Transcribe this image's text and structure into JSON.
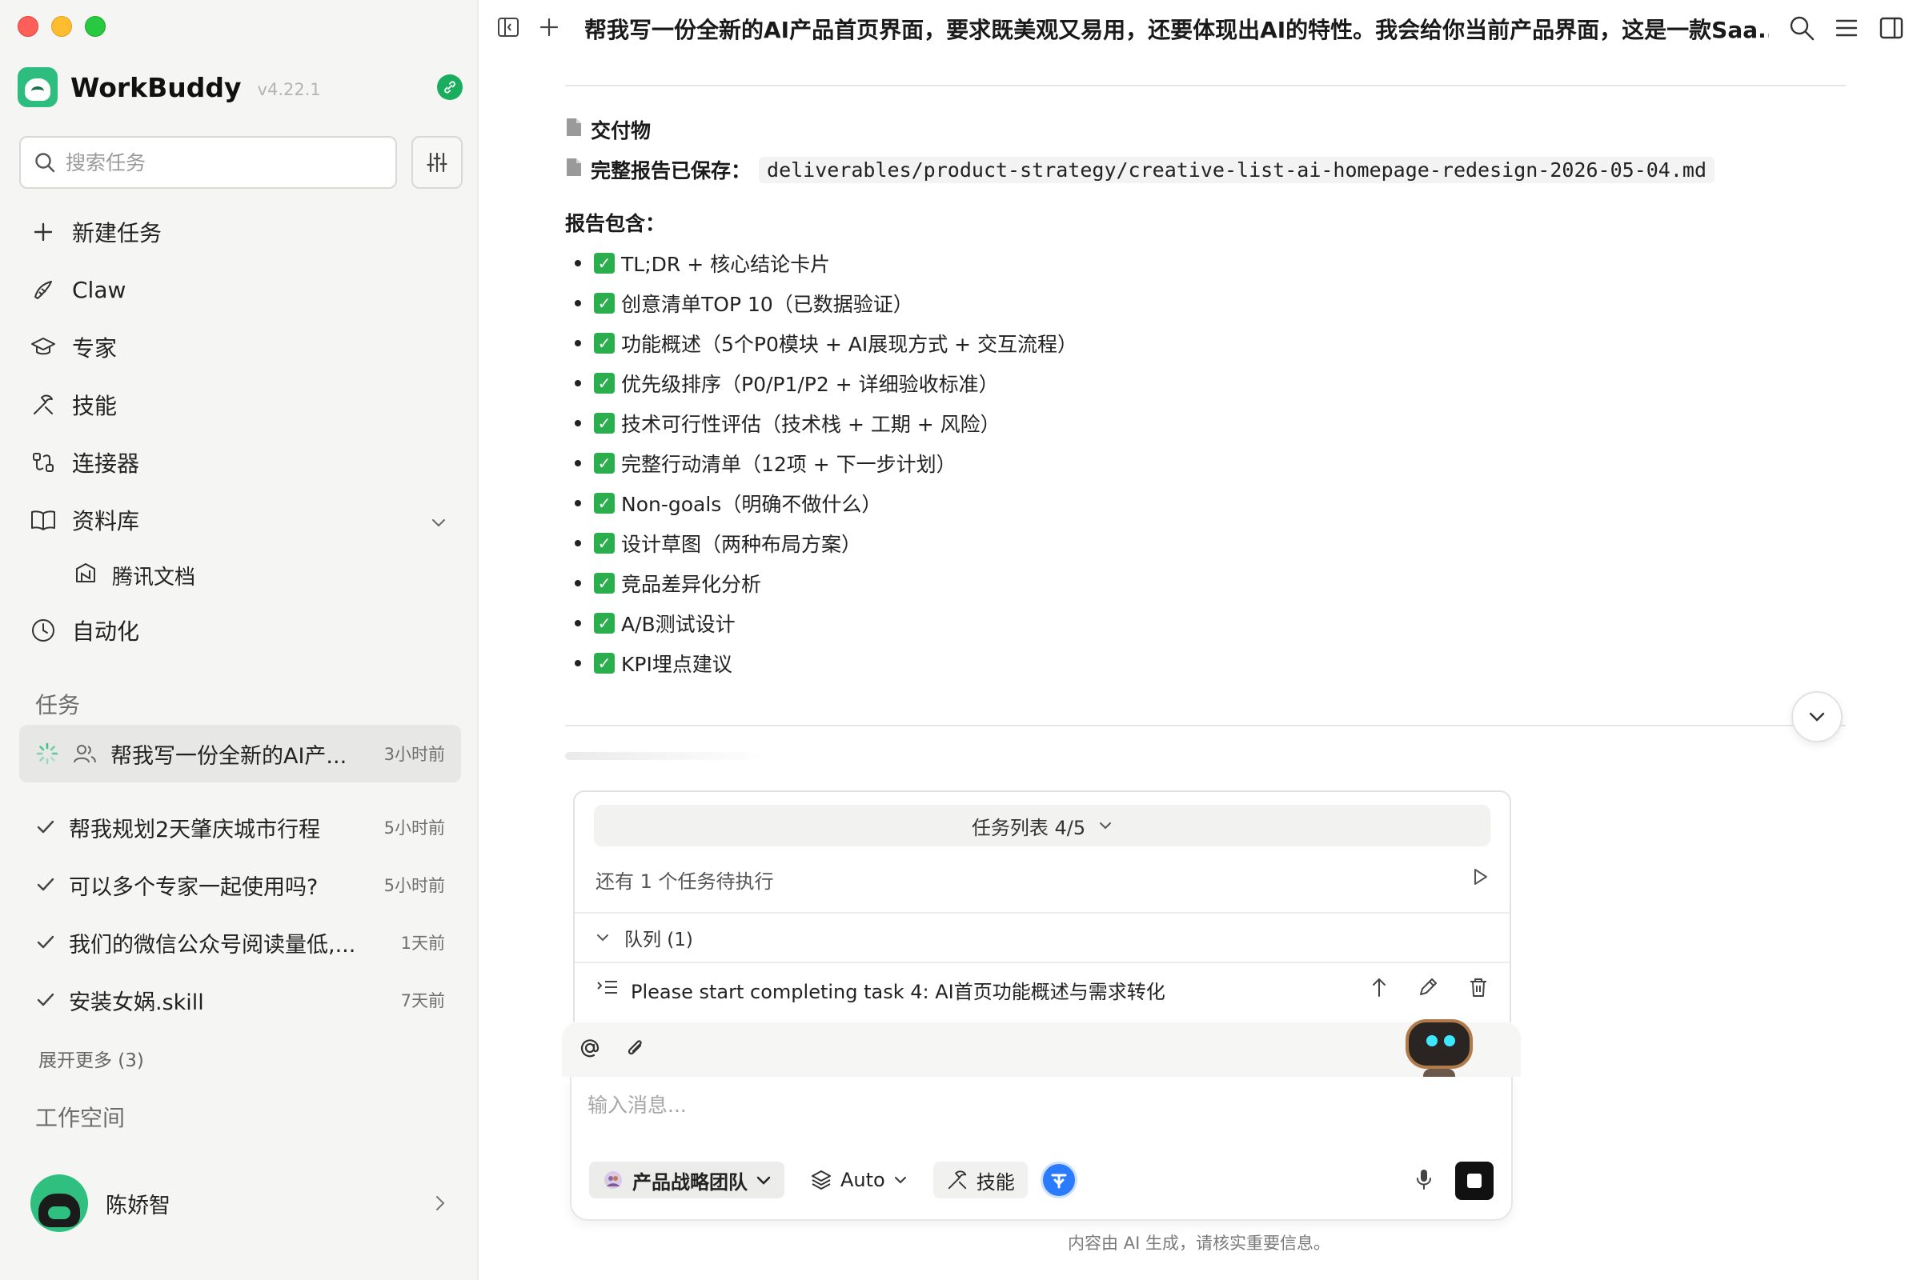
{
  "app": {
    "name": "WorkBuddy",
    "version": "v4.22.1"
  },
  "sidebar": {
    "search_placeholder": "搜索任务",
    "nav": [
      {
        "label": "新建任务",
        "icon": "plus-icon"
      },
      {
        "label": "Claw",
        "icon": "claw-icon"
      },
      {
        "label": "专家",
        "icon": "graduation-cap-icon"
      },
      {
        "label": "技能",
        "icon": "tools-icon"
      },
      {
        "label": "连接器",
        "icon": "plug-icon"
      },
      {
        "label": "资料库",
        "icon": "book-icon"
      },
      {
        "label": "自动化",
        "icon": "clock-icon"
      }
    ],
    "library_sub": "腾讯文档",
    "tasks_label": "任务",
    "tasks": [
      {
        "title": "帮我写一份全新的AI产...",
        "time": "3小时前",
        "status": "running"
      },
      {
        "title": "帮我规划2天肇庆城市行程",
        "time": "5小时前",
        "status": "done"
      },
      {
        "title": "可以多个专家一起使用吗?",
        "time": "5小时前",
        "status": "done"
      },
      {
        "title": "我们的微信公众号阅读量低,...",
        "time": "1天前",
        "status": "done"
      },
      {
        "title": "安装女娲.skill",
        "time": "7天前",
        "status": "done"
      }
    ],
    "show_more": "展开更多 (3)",
    "workspace_label": "工作空间",
    "user_name": "陈娇智"
  },
  "topbar": {
    "title": "帮我写一份全新的AI产品首页界面，要求既美观又易用，还要体现出AI的特性。我会给你当前产品界面，这是一款Saa..."
  },
  "content": {
    "deliverables_label": "交付物",
    "report_saved_label": "完整报告已保存：",
    "report_path": "deliverables/product-strategy/creative-list-ai-homepage-redesign-2026-05-04.md",
    "report_includes_label": "报告包含：",
    "items": [
      "TL;DR + 核心结论卡片",
      "创意清单TOP 10（已数据验证）",
      "功能概述（5个P0模块 + AI展现方式 + 交互流程）",
      "优先级排序（P0/P1/P2 + 详细验收标准）",
      "技术可行性评估（技术栈 + 工期 + 风险）",
      "完整行动清单（12项 + 下一步计划）",
      "Non-goals（明确不做什么）",
      "设计草图（两种布局方案）",
      "竞品差异化分析",
      "A/B测试设计",
      "KPI埋点建议"
    ]
  },
  "queue": {
    "header": "任务列表 4/5",
    "pending": "还有 1 个任务待执行",
    "group": "队列 (1)",
    "item": "Please start completing task 4: AI首页功能概述与需求转化"
  },
  "composer": {
    "placeholder": "输入消息...",
    "team": "产品战略团队",
    "model": "Auto",
    "skill": "技能"
  },
  "footnote": "内容由 AI 生成，请核实重要信息。",
  "colors": {
    "accent_green": "#2dbd7e",
    "check_green": "#2aae4e",
    "link_blue": "#2b7bff"
  }
}
